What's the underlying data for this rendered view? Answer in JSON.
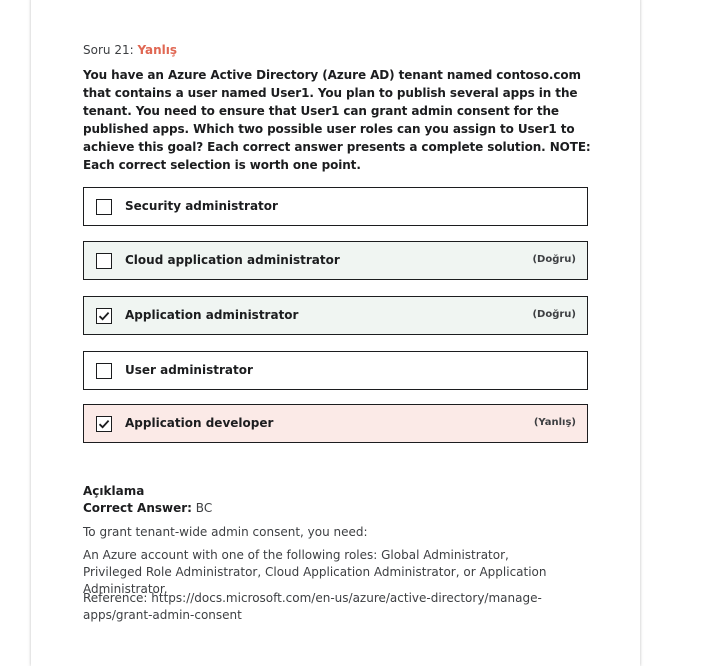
{
  "question": {
    "number_label": "Soru 21:",
    "status": "Yanlış",
    "text": "You have an Azure Active Directory (Azure AD) tenant named contoso.com that contains a user named User1. You plan to publish several apps in the tenant. You need to ensure that User1 can grant admin consent for the published apps. Which two possible user roles can you assign to User1 to achieve this goal? Each correct answer presents a complete solution. NOTE: Each correct selection is worth one point."
  },
  "options": [
    {
      "label": "Security administrator",
      "checked": false,
      "state": "neutral",
      "tag": ""
    },
    {
      "label": "Cloud application administrator",
      "checked": false,
      "state": "correct",
      "tag": "(Doğru)"
    },
    {
      "label": "Application administrator",
      "checked": true,
      "state": "correct",
      "tag": "(Doğru)"
    },
    {
      "label": "User administrator",
      "checked": false,
      "state": "neutral",
      "tag": ""
    },
    {
      "label": "Application developer",
      "checked": true,
      "state": "wrong",
      "tag": "(Yanlış)"
    }
  ],
  "explanation": {
    "title": "Açıklama",
    "correct_answer_label": "Correct Answer:",
    "correct_answer_value": "BC",
    "paragraph1": "To grant tenant-wide admin consent, you need:",
    "paragraph2": "An Azure account with one of the following roles: Global Administrator, Privileged Role Administrator, Cloud Application Administrator, or Application Administrator.",
    "paragraph3": "Reference: https://docs.microsoft.com/en-us/azure/active-directory/manage-apps/grant-admin-consent"
  },
  "colors": {
    "wrong_accent": "#e06753",
    "correct_bg": "#f0f5f2",
    "wrong_bg": "#fbeae7"
  }
}
